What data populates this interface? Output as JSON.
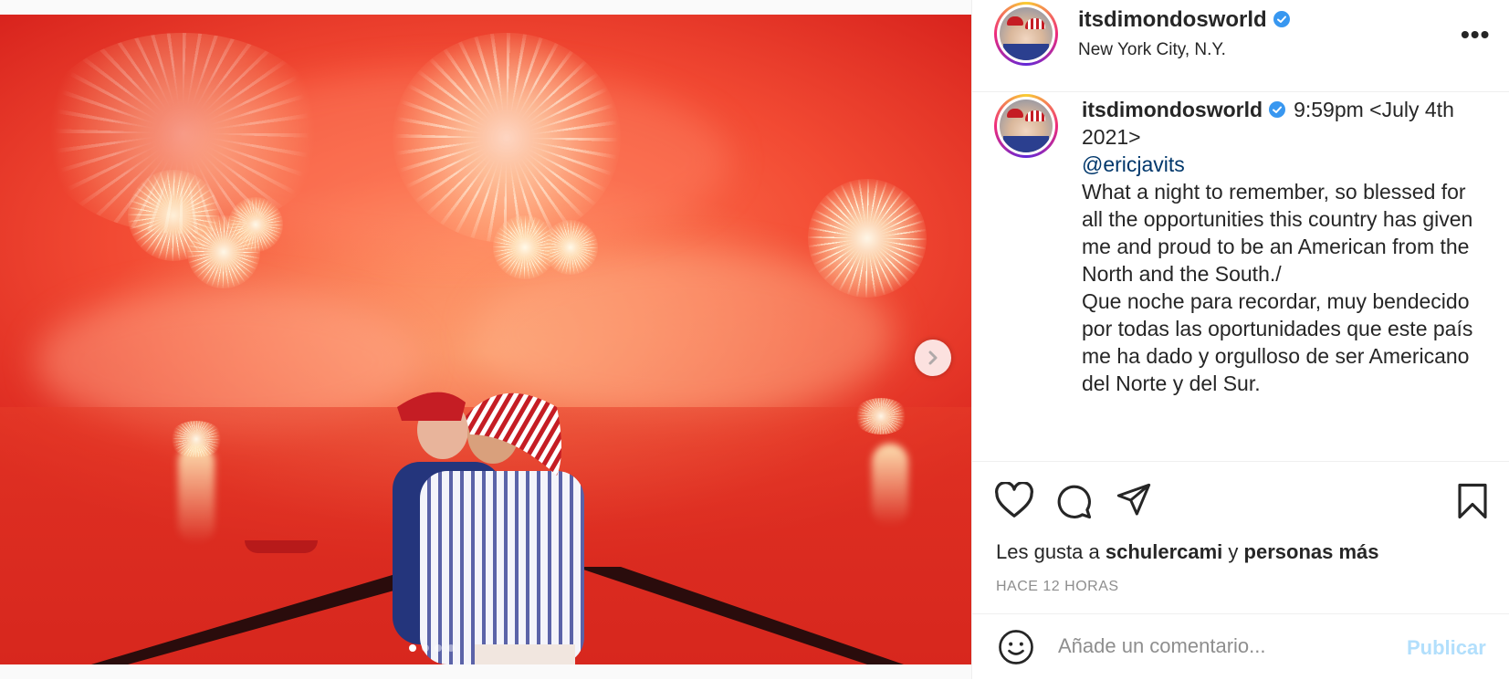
{
  "post": {
    "username": "itsdimondosworld",
    "verified": true,
    "location": "New York City, N.Y.",
    "more_label": "•••",
    "image": {
      "carousel_index": 1,
      "carousel_count": 4,
      "next_icon": "chevron-right-icon"
    },
    "caption": {
      "username": "itsdimondosworld",
      "time": "9:59pm <July 4th 2021>",
      "mention": "@ericjavits",
      "paragraph_en": "What a night to remember, so blessed for all the opportunities this country has given me and proud to be an American from the North and the South./",
      "paragraph_es": "Que noche para recordar, muy bendecido por todas las oportunidades que este país me ha dado y orgulloso de ser Americano del Norte y del Sur."
    },
    "actions": {
      "like_icon": "heart-icon",
      "comment_icon": "comment-bubble-icon",
      "share_icon": "paper-plane-icon",
      "save_icon": "bookmark-icon"
    },
    "likes": {
      "prefix": "Les gusta a",
      "user": "schulercami",
      "joiner": "y",
      "others": "personas más"
    },
    "time_ago": "HACE 12 HORAS",
    "comment": {
      "emoji_icon": "smiley-icon",
      "placeholder": "Añade un comentario...",
      "publish_label": "Publicar"
    }
  }
}
